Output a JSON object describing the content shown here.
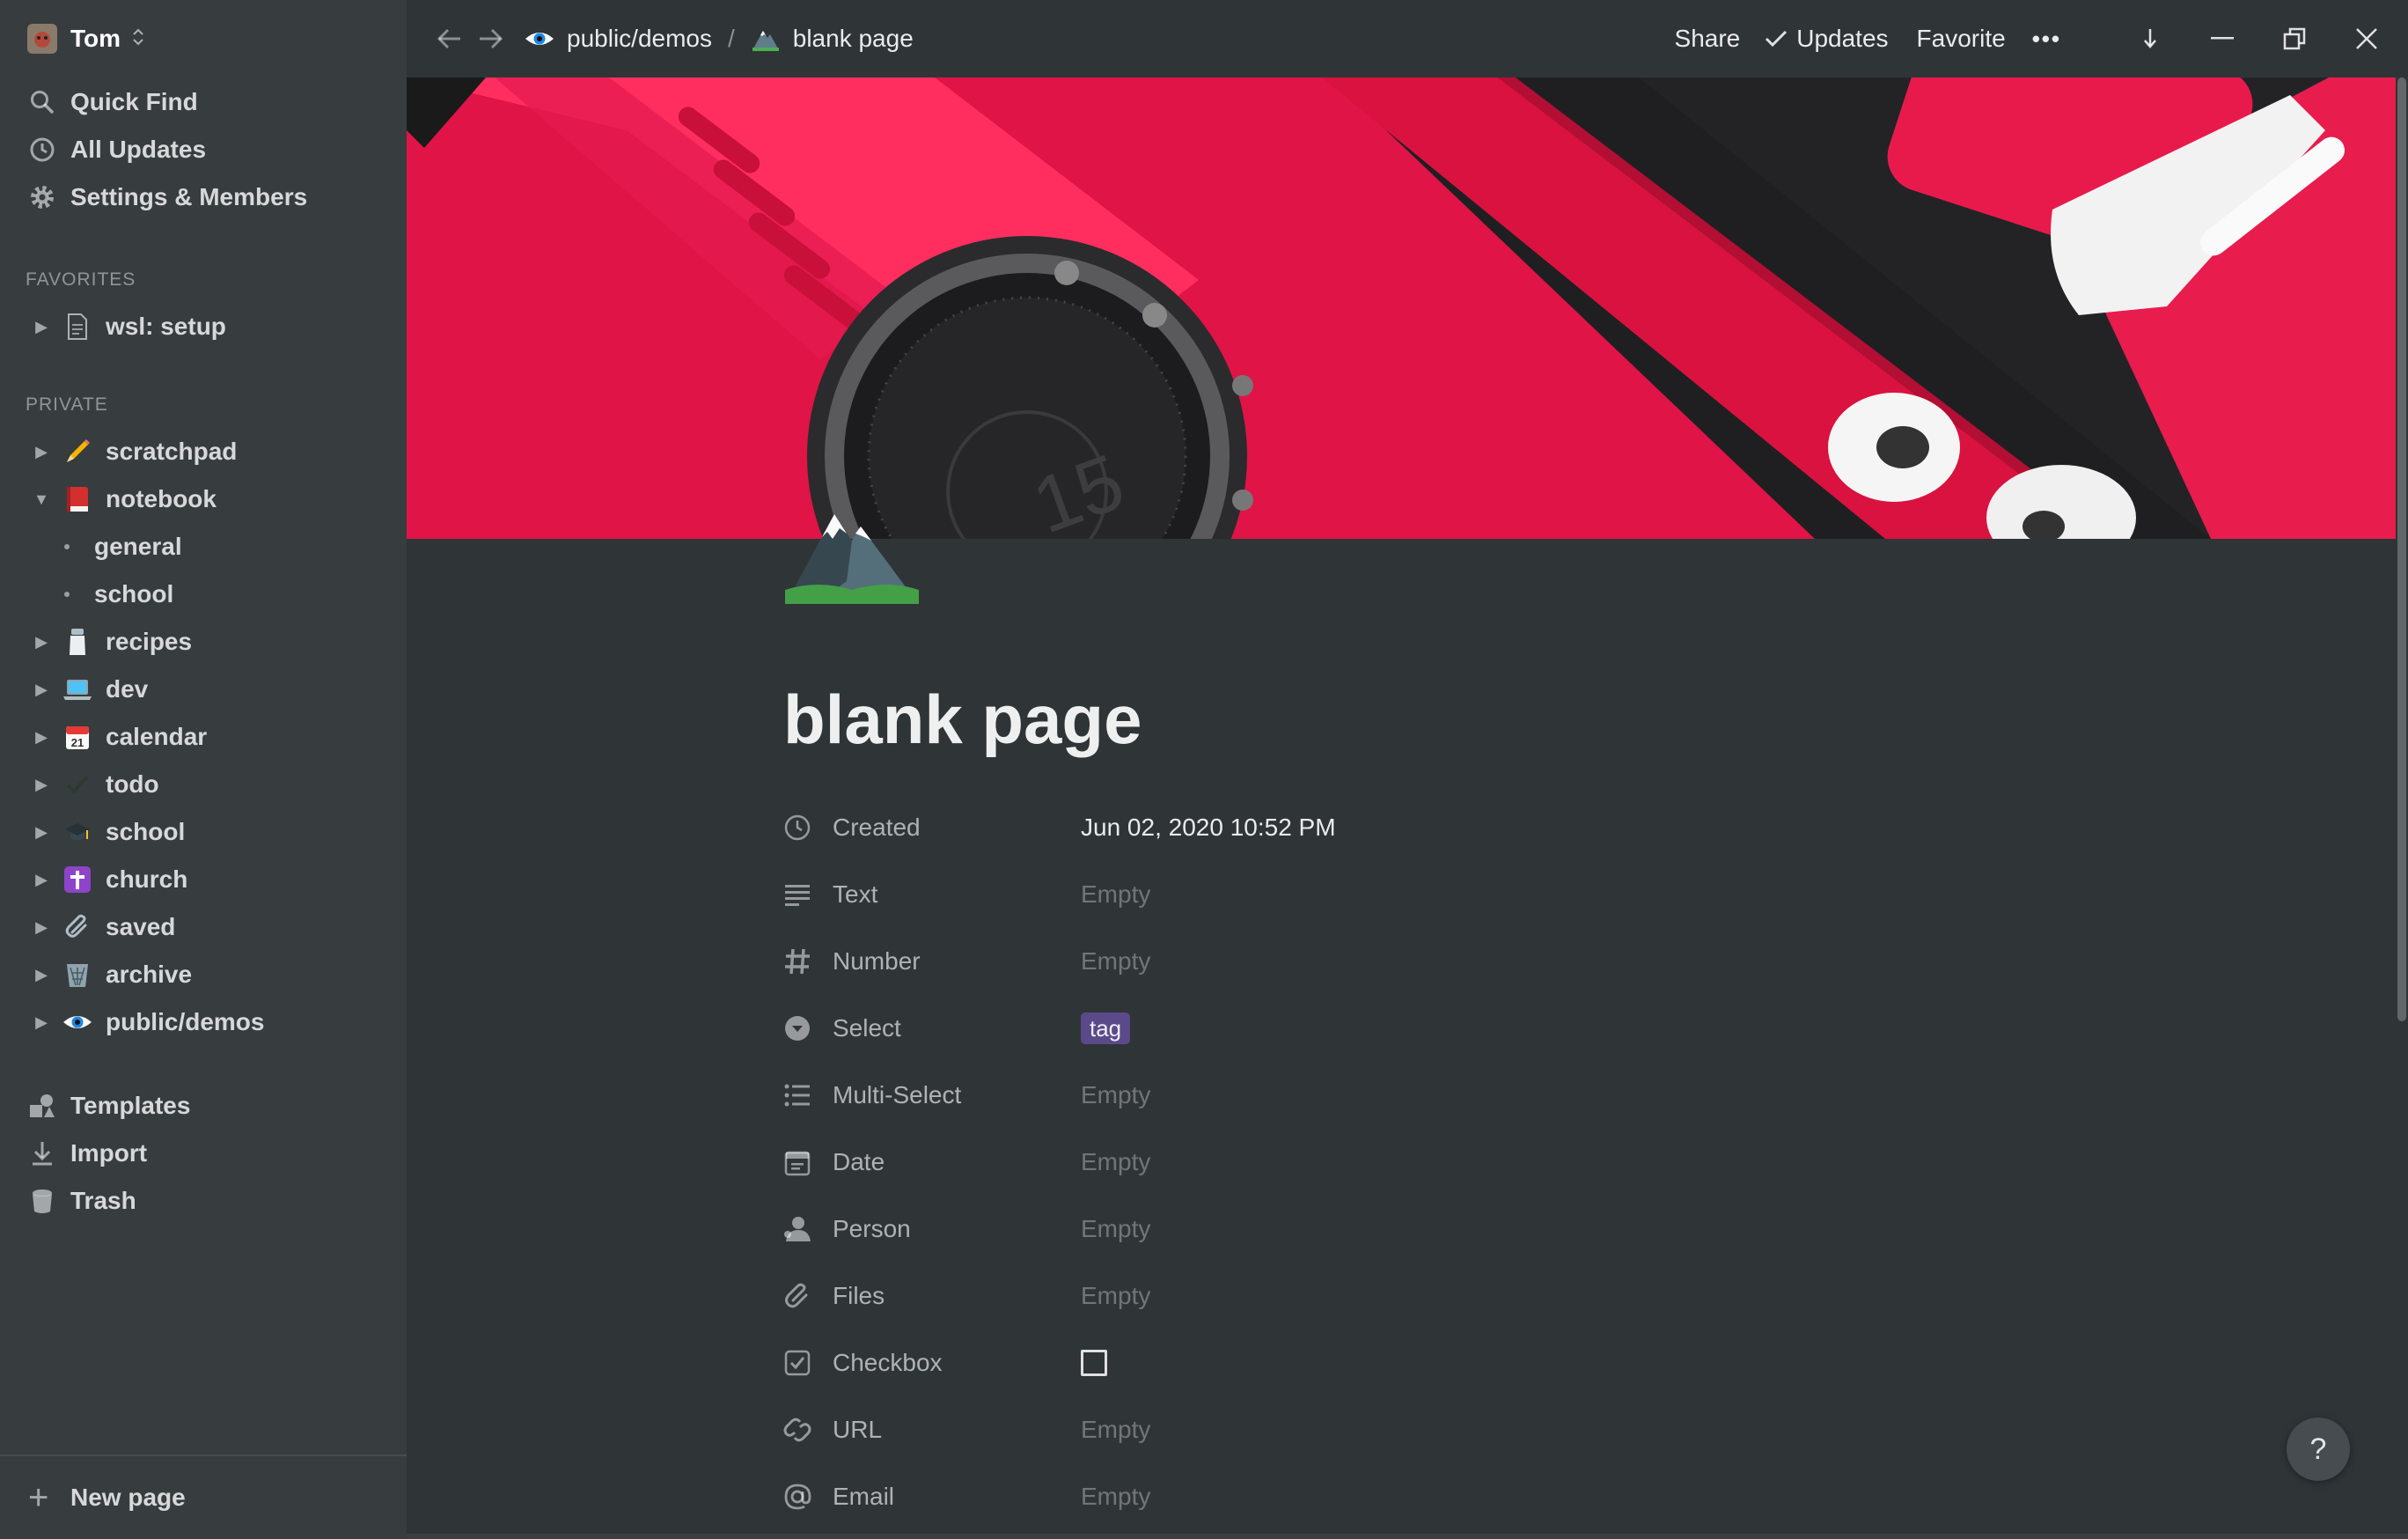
{
  "workspace": {
    "name": "Tom",
    "switcher_icon": "chevron-up-down-icon"
  },
  "sidebar": {
    "top_items": [
      {
        "label": "Quick Find",
        "icon": "search-icon"
      },
      {
        "label": "All Updates",
        "icon": "clock-icon"
      },
      {
        "label": "Settings & Members",
        "icon": "gear-icon"
      }
    ],
    "favorites_heading": "FAVORITES",
    "favorites": [
      {
        "label": "wsl: setup",
        "icon": "document-icon"
      }
    ],
    "private_heading": "PRIVATE",
    "private": [
      {
        "label": "scratchpad",
        "icon": "pencil-emoji"
      },
      {
        "label": "notebook",
        "icon": "red-book-emoji",
        "expanded": true
      },
      {
        "label": "general",
        "child": true
      },
      {
        "label": "school",
        "child": true
      },
      {
        "label": "recipes",
        "icon": "salt-emoji"
      },
      {
        "label": "dev",
        "icon": "laptop-emoji"
      },
      {
        "label": "calendar",
        "icon": "calendar-emoji",
        "icon_text": "21"
      },
      {
        "label": "todo",
        "icon": "checkmark-emoji"
      },
      {
        "label": "school",
        "icon": "graduation-cap-emoji"
      },
      {
        "label": "church",
        "icon": "cross-emoji"
      },
      {
        "label": "saved",
        "icon": "paperclip-emoji"
      },
      {
        "label": "archive",
        "icon": "wastebasket-emoji"
      },
      {
        "label": "public/demos",
        "icon": "eye-emoji"
      }
    ],
    "bottom_items": [
      {
        "label": "Templates",
        "icon": "shapes-icon"
      },
      {
        "label": "Import",
        "icon": "download-icon"
      },
      {
        "label": "Trash",
        "icon": "trash-icon"
      }
    ],
    "new_page": "New page"
  },
  "topbar": {
    "breadcrumb": [
      {
        "label": "public/demos",
        "icon": "eye-emoji"
      },
      {
        "label": "blank page",
        "icon": "mountain-emoji"
      }
    ],
    "separator": "/",
    "share": "Share",
    "updates": "Updates",
    "favorite": "Favorite",
    "more": "•••"
  },
  "page": {
    "title": "blank page",
    "icon": "snow-capped-mountain-emoji",
    "properties": [
      {
        "name": "Created",
        "icon": "clock-icon",
        "value": "Jun 02, 2020 10:52 PM",
        "state": "filled"
      },
      {
        "name": "Text",
        "icon": "text-lines-icon",
        "value": "Empty",
        "state": "empty"
      },
      {
        "name": "Number",
        "icon": "hash-icon",
        "value": "Empty",
        "state": "empty"
      },
      {
        "name": "Select",
        "icon": "select-circle-icon",
        "value": "tag",
        "state": "tag"
      },
      {
        "name": "Multi-Select",
        "icon": "list-icon",
        "value": "Empty",
        "state": "empty"
      },
      {
        "name": "Date",
        "icon": "calendar-icon",
        "value": "Empty",
        "state": "empty"
      },
      {
        "name": "Person",
        "icon": "person-icon",
        "value": "Empty",
        "state": "empty"
      },
      {
        "name": "Files",
        "icon": "paperclip-icon",
        "value": "Empty",
        "state": "empty"
      },
      {
        "name": "Checkbox",
        "icon": "checkbox-icon",
        "value": "",
        "state": "checkbox",
        "checked": false
      },
      {
        "name": "URL",
        "icon": "link-icon",
        "value": "Empty",
        "state": "empty"
      },
      {
        "name": "Email",
        "icon": "at-icon",
        "value": "Empty",
        "state": "empty"
      }
    ]
  },
  "help": "?",
  "colors": {
    "sidebar_bg": "#373c3f",
    "main_bg": "#2f3437",
    "tag_bg": "#5a4a8a",
    "cover_red": "#e8174a"
  }
}
